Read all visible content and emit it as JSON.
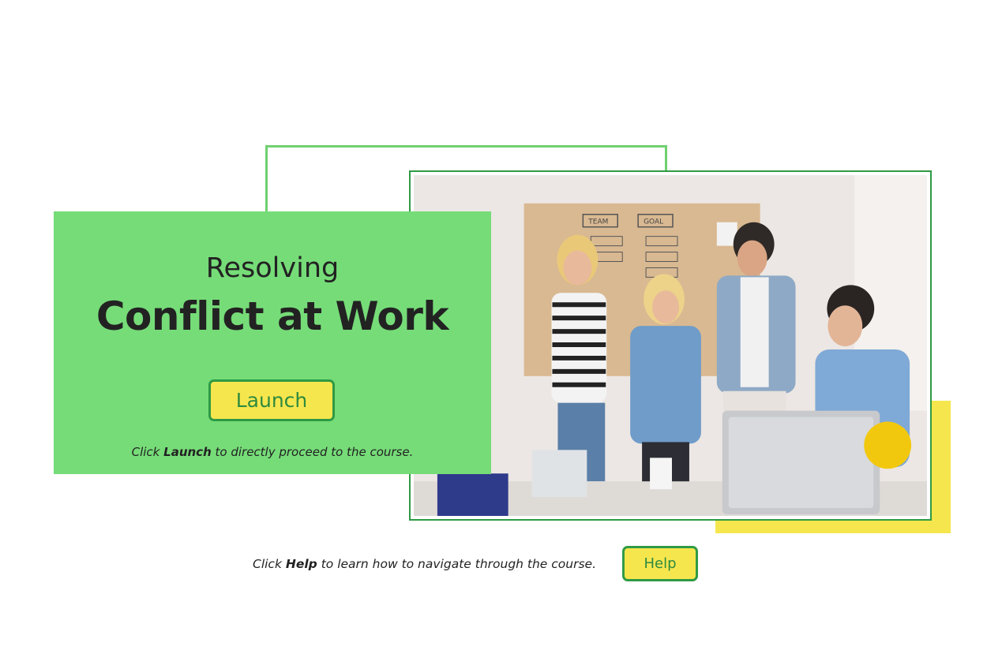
{
  "hero": {
    "subtitle": "Resolving",
    "title": "Conflict at Work",
    "launch_label": "Launch",
    "launch_hint_prefix": "Click ",
    "launch_hint_bold": "Launch",
    "launch_hint_suffix": " to directly proceed to the course."
  },
  "help": {
    "hint_prefix": "Click ",
    "hint_bold": "Help",
    "hint_suffix": " to learn how to navigate through the course.",
    "button_label": "Help"
  },
  "photo": {
    "board_labels": [
      "TEAM",
      "GOAL"
    ]
  },
  "colors": {
    "panel_green": "#76dc78",
    "frame_green": "#2f9a44",
    "accent_yellow": "#f6e64e"
  }
}
